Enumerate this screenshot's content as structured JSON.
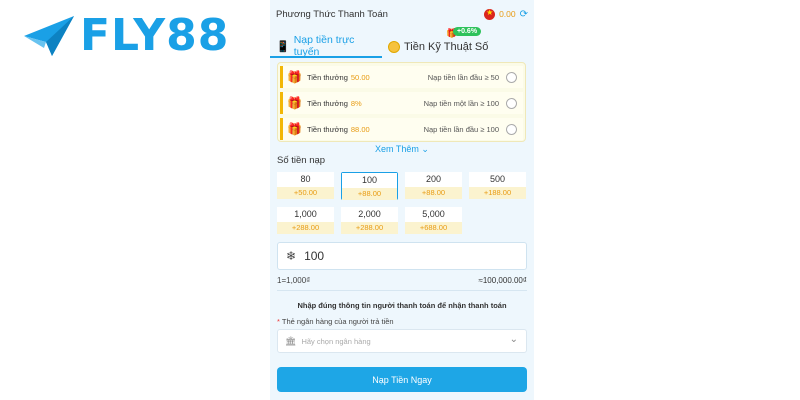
{
  "brand": {
    "name": "FLY88",
    "color": "#1aa0e6"
  },
  "header": {
    "title": "Phương Thức Thanh Toán",
    "balance": "0.00"
  },
  "tabs": [
    {
      "label": "Nạp tiền trực tuyến",
      "icon": "mobile-payment-icon",
      "active": true
    },
    {
      "label": "Tiền Kỹ Thuật Số",
      "icon": "coin-icon",
      "active": false,
      "badge": "+0.6%"
    }
  ],
  "bonuses": [
    {
      "label": "Tiền thưởng",
      "amount": "50.00",
      "condition": "Nạp tiền lần đầu ≥ 50"
    },
    {
      "label": "Tiền thưởng",
      "amount": "8%",
      "condition": "Nạp tiền một lần ≥ 100"
    },
    {
      "label": "Tiền thưởng",
      "amount": "88.00",
      "condition": "Nạp tiền lần đầu ≥ 100"
    }
  ],
  "more_label": "Xem Thêm",
  "amount_section": {
    "title": "Số tiền nạp",
    "options": [
      {
        "value": "80",
        "bonus": "+50.00"
      },
      {
        "value": "100",
        "bonus": "+88.00",
        "selected": true
      },
      {
        "value": "200",
        "bonus": "+88.00"
      },
      {
        "value": "500",
        "bonus": "+188.00"
      },
      {
        "value": "1,000",
        "bonus": "+288.00"
      },
      {
        "value": "2,000",
        "bonus": "+288.00"
      },
      {
        "value": "5,000",
        "bonus": "+688.00"
      }
    ]
  },
  "input": {
    "value": "100"
  },
  "rate": "1=1,000₫",
  "total": "≈100,000.00₫",
  "notice": "Nhập đúng thông tin người thanh toán để nhận thanh toán",
  "bank_field": {
    "label": "Thẻ ngân hàng của người trả tiền",
    "placeholder": "Hãy chọn ngân hàng"
  },
  "submit_label": "Nạp Tiền Ngay"
}
